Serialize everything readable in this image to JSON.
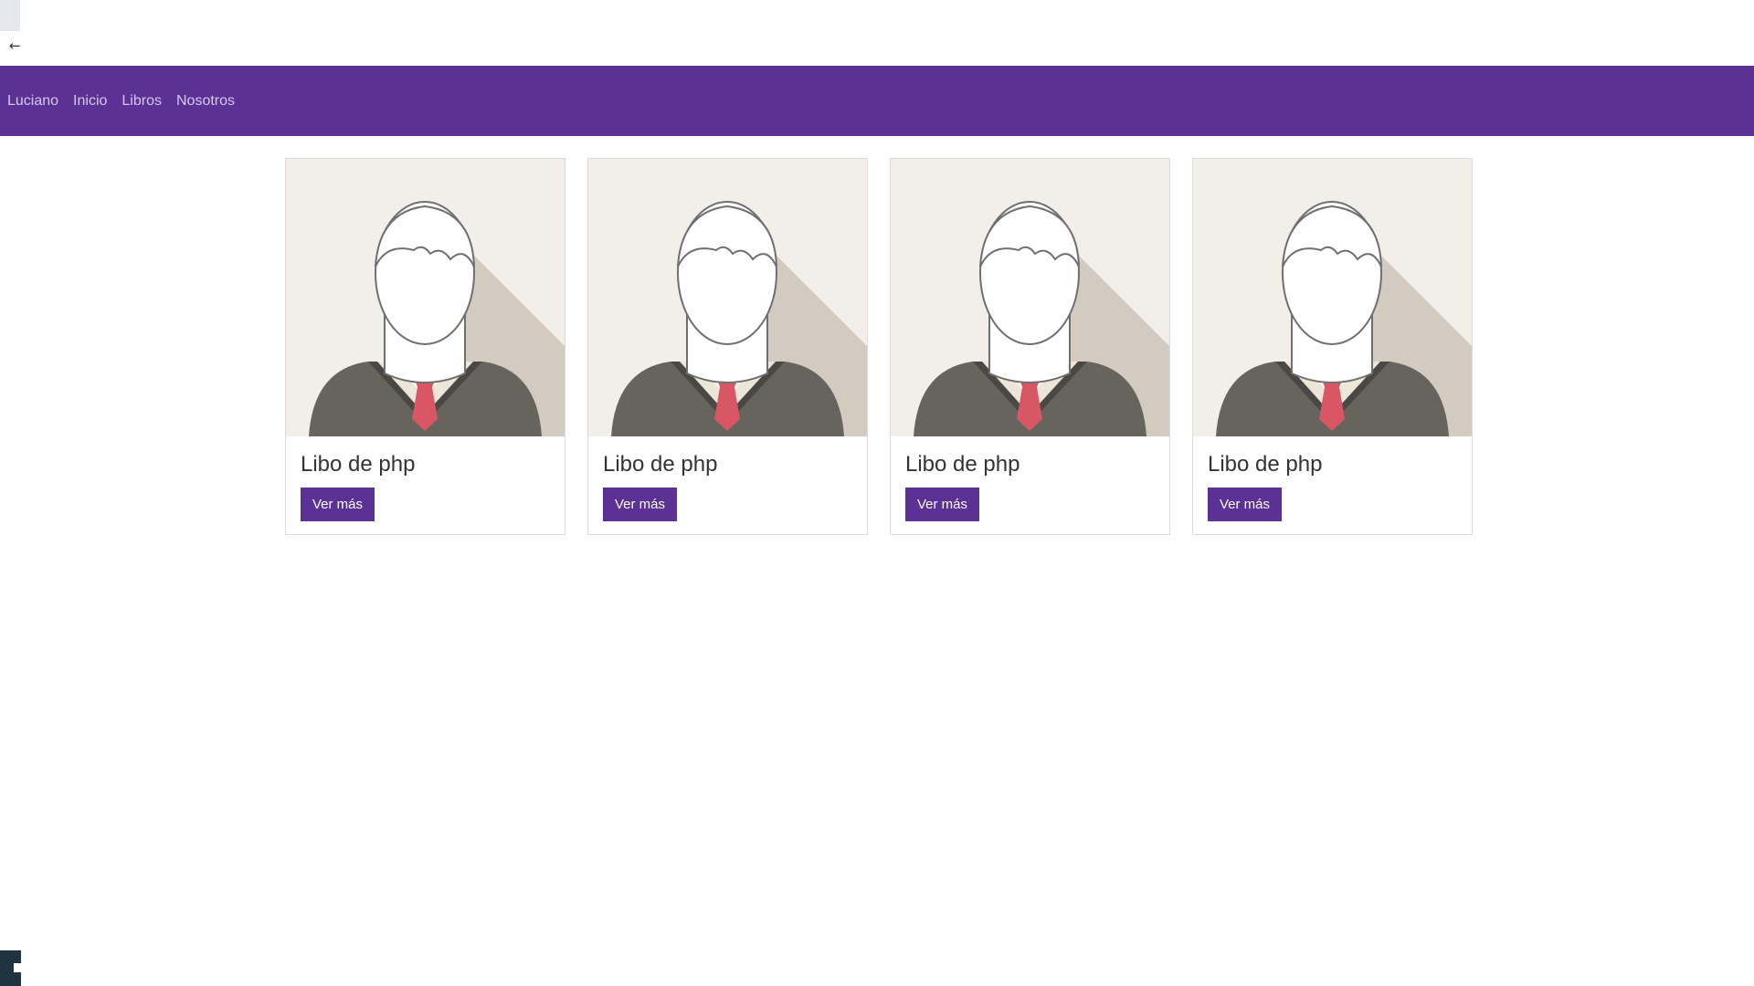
{
  "navbar": {
    "brand": "Luciano",
    "links": [
      "Inicio",
      "Libros",
      "Nosotros"
    ]
  },
  "cards": [
    {
      "title": "Libo de php",
      "button": "Ver más"
    },
    {
      "title": "Libo de php",
      "button": "Ver más"
    },
    {
      "title": "Libo de php",
      "button": "Ver más"
    },
    {
      "title": "Libo de php",
      "button": "Ver más"
    }
  ],
  "colors": {
    "navbar_bg": "#5b3196",
    "button_bg": "#5b3196",
    "nav_link": "#d7c8ee"
  },
  "icons": {
    "back": "back-arrow-icon",
    "windows": "windows-start-icon",
    "card_image": "avatar-placeholder-image"
  }
}
